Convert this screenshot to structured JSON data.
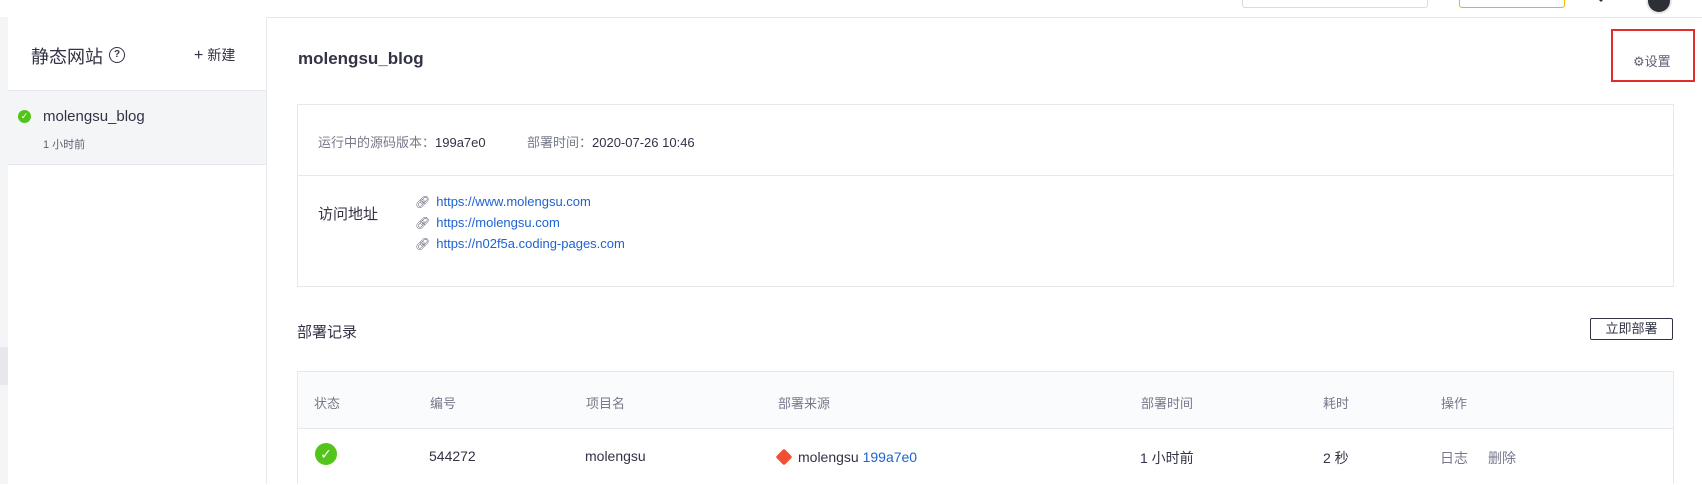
{
  "sidebar": {
    "title": "静态网站",
    "help_icon": "question-circle-icon",
    "new_label": "新建",
    "items": [
      {
        "name": "molengsu_blog",
        "time": "1 小时前",
        "status": "success"
      }
    ]
  },
  "main": {
    "site_title": "molengsu_blog",
    "settings_label": "设置",
    "info": {
      "version_label": "运行中的源码版本：",
      "version_value": "199a7e0",
      "deploy_time_label": "部署时间：",
      "deploy_time_value": "2020-07-26 10:46",
      "access_label": "访问地址",
      "urls": [
        "https://www.molengsu.com",
        "https://molengsu.com",
        "https://n02f5a.coding-pages.com"
      ]
    },
    "records": {
      "title": "部署记录",
      "deploy_now_label": "立即部署",
      "columns": [
        "状态",
        "编号",
        "项目名",
        "部署来源",
        "部署时间",
        "耗时",
        "操作"
      ],
      "rows": [
        {
          "status": "success",
          "id": "544272",
          "project": "molengsu",
          "source_repo": "molengsu",
          "source_commit": "199a7e0",
          "deploy_time": "1 小时前",
          "duration": "2 秒",
          "actions": [
            "日志",
            "删除"
          ]
        }
      ]
    }
  },
  "colors": {
    "accent_link": "#1e62d0",
    "success": "#52c41a",
    "highlight_frame": "#e32d2d",
    "git_brand": "#f05033"
  }
}
